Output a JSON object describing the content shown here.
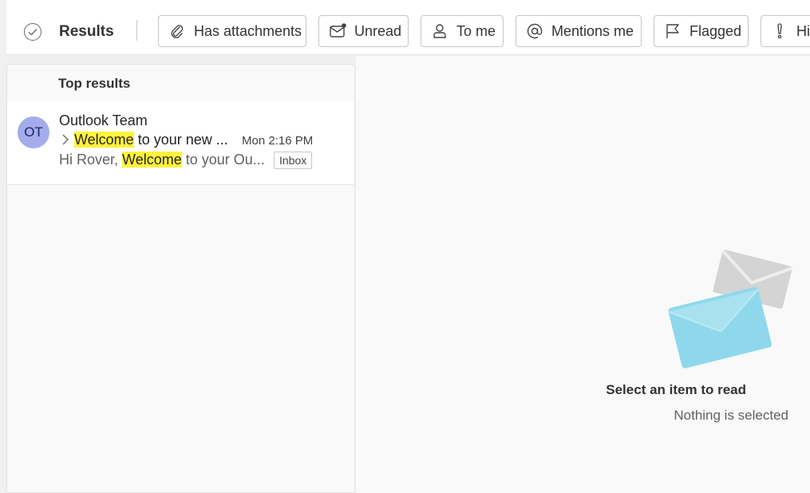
{
  "filter_bar": {
    "results_label": "Results",
    "filters": [
      {
        "label": "Has attachments",
        "icon": "paperclip-icon"
      },
      {
        "label": "Unread",
        "icon": "unread-mail-icon"
      },
      {
        "label": "To me",
        "icon": "person-icon"
      },
      {
        "label": "Mentions me",
        "icon": "at-sign-icon"
      },
      {
        "label": "Flagged",
        "icon": "flag-icon"
      },
      {
        "label": "Hi",
        "icon": "importance-icon"
      }
    ]
  },
  "list": {
    "header": "Top results",
    "items": [
      {
        "avatar_initials": "OT",
        "avatar_color": "#a4acec",
        "sender": "Outlook Team",
        "subject_highlight": "Welcome",
        "subject_rest": " to your new ...",
        "time": "Mon 2:16 PM",
        "preview_prefix": "Hi Rover, ",
        "preview_highlight": "Welcome",
        "preview_rest": " to your Ou...",
        "folder": "Inbox"
      }
    ]
  },
  "reading_pane": {
    "title": "Select an item to read",
    "subtitle": "Nothing is selected"
  },
  "colors": {
    "highlight": "#fff23b",
    "envelope_front": "#8fd8eb",
    "envelope_back": "#d4d4d4"
  }
}
